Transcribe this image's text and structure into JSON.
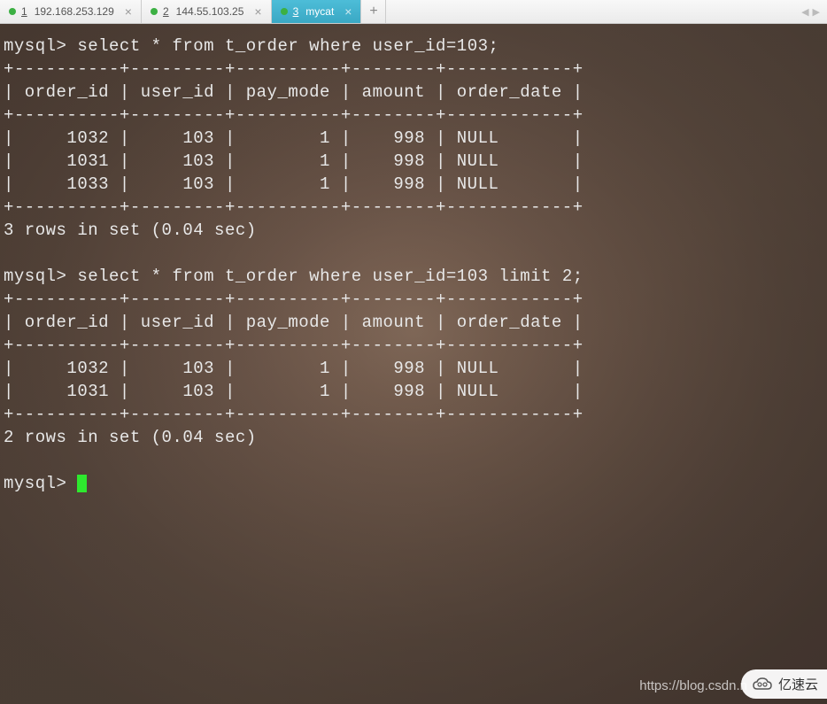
{
  "tabs": [
    {
      "number": "1",
      "label": "192.168.253.129",
      "active": false,
      "status": "green"
    },
    {
      "number": "2",
      "label": "144.55.103.25",
      "active": false,
      "status": "green"
    },
    {
      "number": "3",
      "label": "mycat",
      "active": true,
      "status": "green"
    }
  ],
  "terminal": {
    "prompt": "mysql>",
    "query1": {
      "sql": "select * from t_order where user_id=103;",
      "separator": "+----------+---------+----------+--------+------------+",
      "header": "| order_id | user_id | pay_mode | amount | order_date |",
      "rows": [
        "|     1032 |     103 |        1 |    998 | NULL       |",
        "|     1031 |     103 |        1 |    998 | NULL       |",
        "|     1033 |     103 |        1 |    998 | NULL       |"
      ],
      "footer": "3 rows in set (0.04 sec)"
    },
    "query2": {
      "sql": "select * from t_order where user_id=103 limit 2;",
      "separator": "+----------+---------+----------+--------+------------+",
      "header": "| order_id | user_id | pay_mode | amount | order_date |",
      "rows": [
        "|     1032 |     103 |        1 |    998 | NULL       |",
        "|     1031 |     103 |        1 |    998 | NULL       |"
      ],
      "footer": "2 rows in set (0.04 sec)"
    },
    "data": {
      "table": "t_order",
      "columns": [
        "order_id",
        "user_id",
        "pay_mode",
        "amount",
        "order_date"
      ],
      "result1": [
        {
          "order_id": 1032,
          "user_id": 103,
          "pay_mode": 1,
          "amount": 998,
          "order_date": "NULL"
        },
        {
          "order_id": 1031,
          "user_id": 103,
          "pay_mode": 1,
          "amount": 998,
          "order_date": "NULL"
        },
        {
          "order_id": 1033,
          "user_id": 103,
          "pay_mode": 1,
          "amount": 998,
          "order_date": "NULL"
        }
      ],
      "result2": [
        {
          "order_id": 1032,
          "user_id": 103,
          "pay_mode": 1,
          "amount": 998,
          "order_date": "NULL"
        },
        {
          "order_id": 1031,
          "user_id": 103,
          "pay_mode": 1,
          "amount": 998,
          "order_date": "NULL"
        }
      ]
    }
  },
  "watermark": {
    "url": "https://blog.csdn.n",
    "brand": "亿速云"
  }
}
